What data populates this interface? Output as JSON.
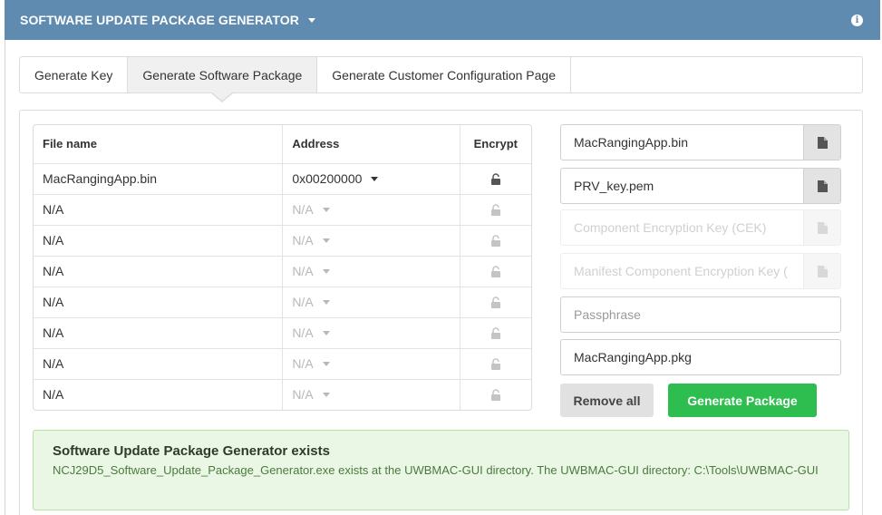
{
  "header": {
    "title": "SOFTWARE UPDATE PACKAGE GENERATOR",
    "info_icon": "info-icon"
  },
  "tabs": [
    {
      "label": "Generate Key",
      "active": false
    },
    {
      "label": "Generate Software Package",
      "active": true
    },
    {
      "label": "Generate Customer Configuration Page",
      "active": false
    }
  ],
  "table": {
    "headers": {
      "file": "File name",
      "address": "Address",
      "encrypt": "Encrypt"
    },
    "rows": [
      {
        "file": "MacRangingApp.bin",
        "address": "0x00200000",
        "enabled": true
      },
      {
        "file": "N/A",
        "address": "N/A",
        "enabled": false
      },
      {
        "file": "N/A",
        "address": "N/A",
        "enabled": false
      },
      {
        "file": "N/A",
        "address": "N/A",
        "enabled": false
      },
      {
        "file": "N/A",
        "address": "N/A",
        "enabled": false
      },
      {
        "file": "N/A",
        "address": "N/A",
        "enabled": false
      },
      {
        "file": "N/A",
        "address": "N/A",
        "enabled": false
      },
      {
        "file": "N/A",
        "address": "N/A",
        "enabled": false
      }
    ]
  },
  "inputs": {
    "binary_file": "MacRangingApp.bin",
    "private_key": "PRV_key.pem",
    "cek_placeholder": "Component Encryption Key (CEK)",
    "mcek_placeholder": "Manifest Component Encryption Key (",
    "passphrase_placeholder": "Passphrase",
    "output_file": "MacRangingApp.pkg"
  },
  "buttons": {
    "remove_all": "Remove all",
    "generate": "Generate Package"
  },
  "alert": {
    "title": "Software Update Package Generator exists",
    "body": "NCJ29D5_Software_Update_Package_Generator.exe exists at the UWBMAC-GUI directory. The UWBMAC-GUI directory: C:\\Tools\\UWBMAC-GUI"
  },
  "colors": {
    "header_bg": "#5f8bb0",
    "generate_bg": "#2dbe4f",
    "alert_bg": "#eaf7e4"
  }
}
